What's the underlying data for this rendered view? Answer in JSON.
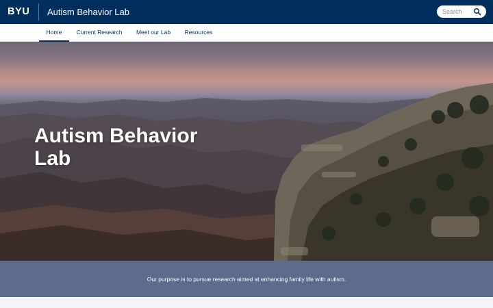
{
  "header": {
    "logo": "BYU",
    "site_title": "Autism Behavior Lab",
    "search": {
      "placeholder": "Search",
      "value": ""
    }
  },
  "nav": {
    "items": [
      {
        "label": "Home",
        "active": true
      },
      {
        "label": "Current Research",
        "active": false
      },
      {
        "label": "Meet our Lab",
        "active": false
      },
      {
        "label": "Resources",
        "active": false
      }
    ]
  },
  "hero": {
    "title": "Autism Behavior Lab",
    "image": "canyon-landscape"
  },
  "purpose": {
    "text": "Our purpose is to pursue research aimed at enhancing family life with autism."
  },
  "colors": {
    "brand_navy": "#002e5d",
    "band_slate": "#5e6c8c",
    "page_bg": "#f3f4f6"
  }
}
